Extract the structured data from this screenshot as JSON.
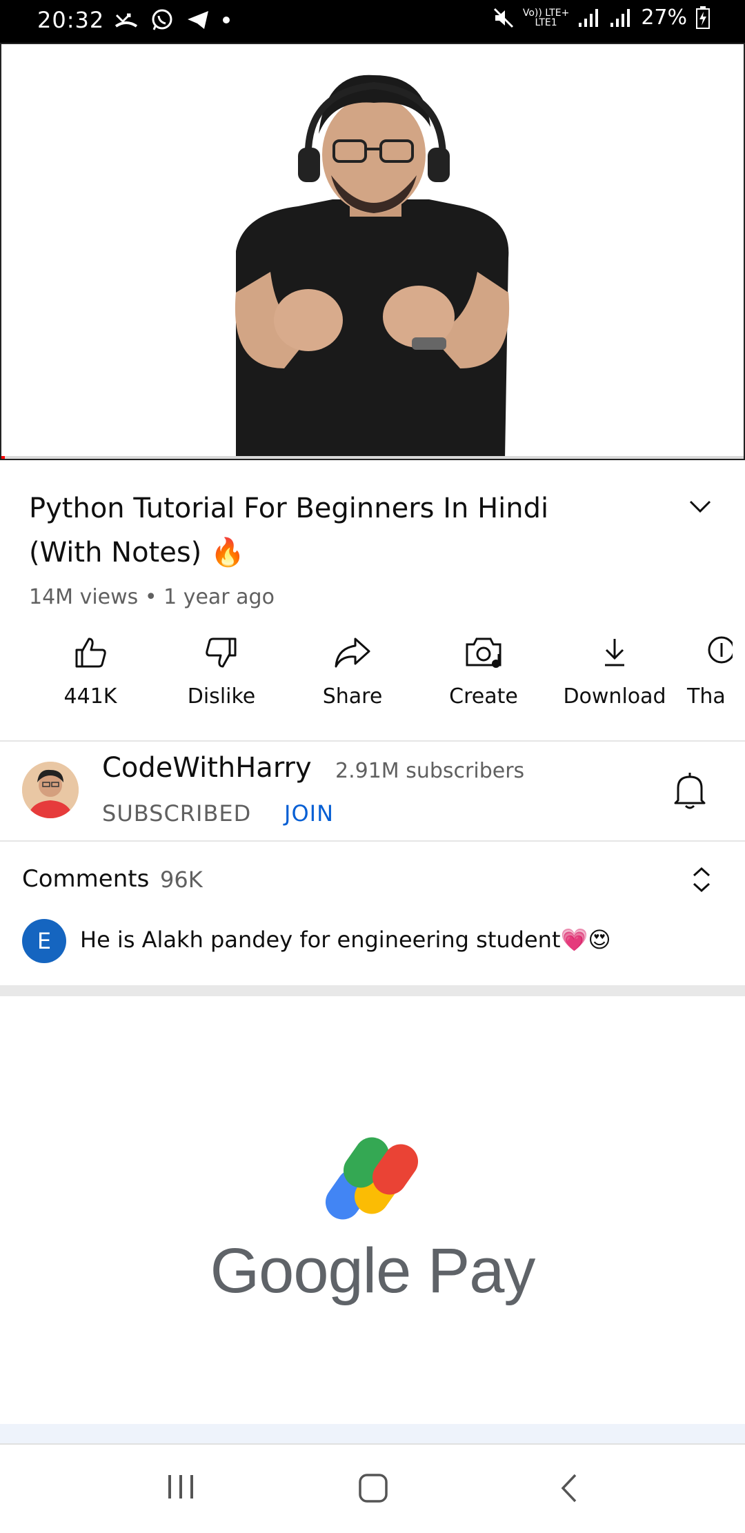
{
  "status_bar": {
    "time": "20:32",
    "network_top": "Vo)) LTE+",
    "network_bottom": "LTE1",
    "battery": "27%"
  },
  "video": {
    "title_line1": "Python Tutorial For Beginners In Hindi",
    "title_line2": "(With Notes)",
    "title_emoji": "🔥",
    "meta": "14M views • 1 year ago",
    "progress_fraction": 0.005
  },
  "actions": [
    {
      "label": "441K",
      "icon": "like-icon"
    },
    {
      "label": "Dislike",
      "icon": "dislike-icon"
    },
    {
      "label": "Share",
      "icon": "share-icon"
    },
    {
      "label": "Create",
      "icon": "create-icon"
    },
    {
      "label": "Download",
      "icon": "download-icon"
    },
    {
      "label": "Tha",
      "icon": "thanks-icon"
    }
  ],
  "channel": {
    "name": "CodeWithHarry",
    "subscribers": "2.91M subscribers",
    "subscribed_label": "SUBSCRIBED",
    "join_label": "JOIN"
  },
  "comments": {
    "title": "Comments",
    "count": "96K",
    "top_comment_avatar": "E",
    "top_comment_text": "He is Alakh pandey for engineering student💗😍"
  },
  "ad": {
    "brand": "Google Pay"
  },
  "colors": {
    "accent_blue": "#065fd4",
    "progress_red": "#ff0000",
    "status_bar": "#000000"
  }
}
